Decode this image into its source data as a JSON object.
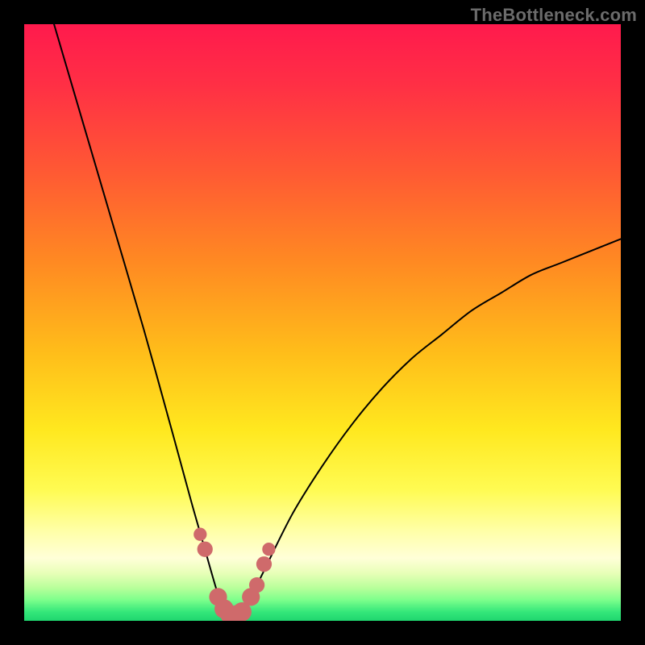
{
  "watermark": "TheBottleneck.com",
  "chart_data": {
    "type": "line",
    "title": "",
    "xlabel": "",
    "ylabel": "",
    "xlim": [
      0,
      100
    ],
    "ylim": [
      0,
      100
    ],
    "optimum_x": 35,
    "left_curve": {
      "name": "left-branch",
      "x": [
        5,
        10,
        15,
        20,
        25,
        28,
        30,
        32,
        33,
        34,
        35
      ],
      "y": [
        100,
        83,
        66,
        49,
        31,
        20,
        13,
        6,
        3,
        1,
        0
      ]
    },
    "right_curve": {
      "name": "right-branch",
      "x": [
        35,
        37,
        40,
        45,
        50,
        55,
        60,
        65,
        70,
        75,
        80,
        85,
        90,
        95,
        100
      ],
      "y": [
        0,
        2,
        8,
        18,
        26,
        33,
        39,
        44,
        48,
        52,
        55,
        58,
        60,
        62,
        64
      ]
    },
    "marker_points": {
      "name": "highlighted-points",
      "color": "#cf6a6b",
      "x": [
        29.5,
        30.3,
        32.5,
        33.5,
        34.5,
        35.5,
        36.5,
        38.0,
        39.0,
        40.2,
        41.0
      ],
      "y": [
        14.5,
        12.0,
        4.0,
        2.0,
        1.0,
        1.0,
        1.5,
        4.0,
        6.0,
        9.5,
        12.0
      ],
      "r": [
        1.1,
        1.3,
        1.5,
        1.6,
        1.6,
        1.6,
        1.6,
        1.5,
        1.3,
        1.3,
        1.1
      ]
    },
    "background_gradient": {
      "stops": [
        {
          "offset": 0.0,
          "color": "#ff1a4d"
        },
        {
          "offset": 0.1,
          "color": "#ff2f45"
        },
        {
          "offset": 0.25,
          "color": "#ff5a33"
        },
        {
          "offset": 0.4,
          "color": "#ff8a22"
        },
        {
          "offset": 0.55,
          "color": "#ffbd1a"
        },
        {
          "offset": 0.68,
          "color": "#ffe81f"
        },
        {
          "offset": 0.78,
          "color": "#fffb52"
        },
        {
          "offset": 0.85,
          "color": "#ffffa8"
        },
        {
          "offset": 0.895,
          "color": "#ffffd8"
        },
        {
          "offset": 0.92,
          "color": "#e8ffb8"
        },
        {
          "offset": 0.945,
          "color": "#b8ff9a"
        },
        {
          "offset": 0.965,
          "color": "#7dff8c"
        },
        {
          "offset": 0.985,
          "color": "#34e77a"
        },
        {
          "offset": 1.0,
          "color": "#1fd66f"
        }
      ]
    }
  }
}
